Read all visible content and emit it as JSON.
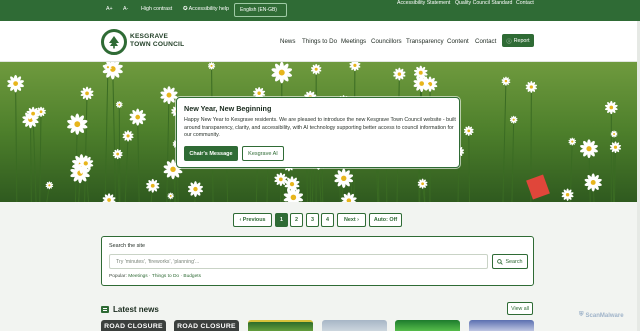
{
  "topbar": {
    "text_increase": "A+",
    "text_decrease": "A-",
    "high_contrast": "High contrast",
    "accessibility_help": "Accessibility help",
    "language": "English (EN-GB)",
    "links": [
      "Accessibility Statement",
      "Quality Council Standard",
      "Contact"
    ]
  },
  "header": {
    "brand_line1": "KESGRAVE",
    "brand_line2": "TOWN COUNCIL",
    "nav": [
      "News",
      "Things to Do",
      "Meetings",
      "Councillors",
      "Transparency",
      "Content",
      "Contact"
    ],
    "report_label": "Report"
  },
  "hero": {
    "title": "New Year, New Beginning",
    "body": "Happy New Year to Kesgrave residents. We are pleased to introduce the new Kesgrave Town Council website - built around transparency, clarity, and accessibility, with AI technology supporting better access to council information for our community.",
    "primary_button": "Chair's Message",
    "secondary_button": "Kesgrave AI"
  },
  "pager": {
    "previous": "Previous",
    "pages": [
      "1",
      "2",
      "3",
      "4"
    ],
    "active_page": "1",
    "next": "Next",
    "auto": "Auto: Off"
  },
  "search": {
    "label": "Search the site",
    "placeholder": "Try 'minutes', 'fireworks', 'planning'...",
    "button": "Search",
    "popular_label": "Popular:",
    "popular_links": [
      "Meetings",
      "Things to Do",
      "Budgets"
    ],
    "separator": "·"
  },
  "news": {
    "title": "Latest news",
    "view_all": "View all",
    "thumb_labels": [
      "ROAD CLOSURE",
      "ROAD CLOSURE"
    ]
  },
  "watermark": "ScanMalware",
  "colors": {
    "brand_green": "#2f6b35",
    "topbar_green": "#2f6b35",
    "page_background": "#f2f4f1"
  }
}
